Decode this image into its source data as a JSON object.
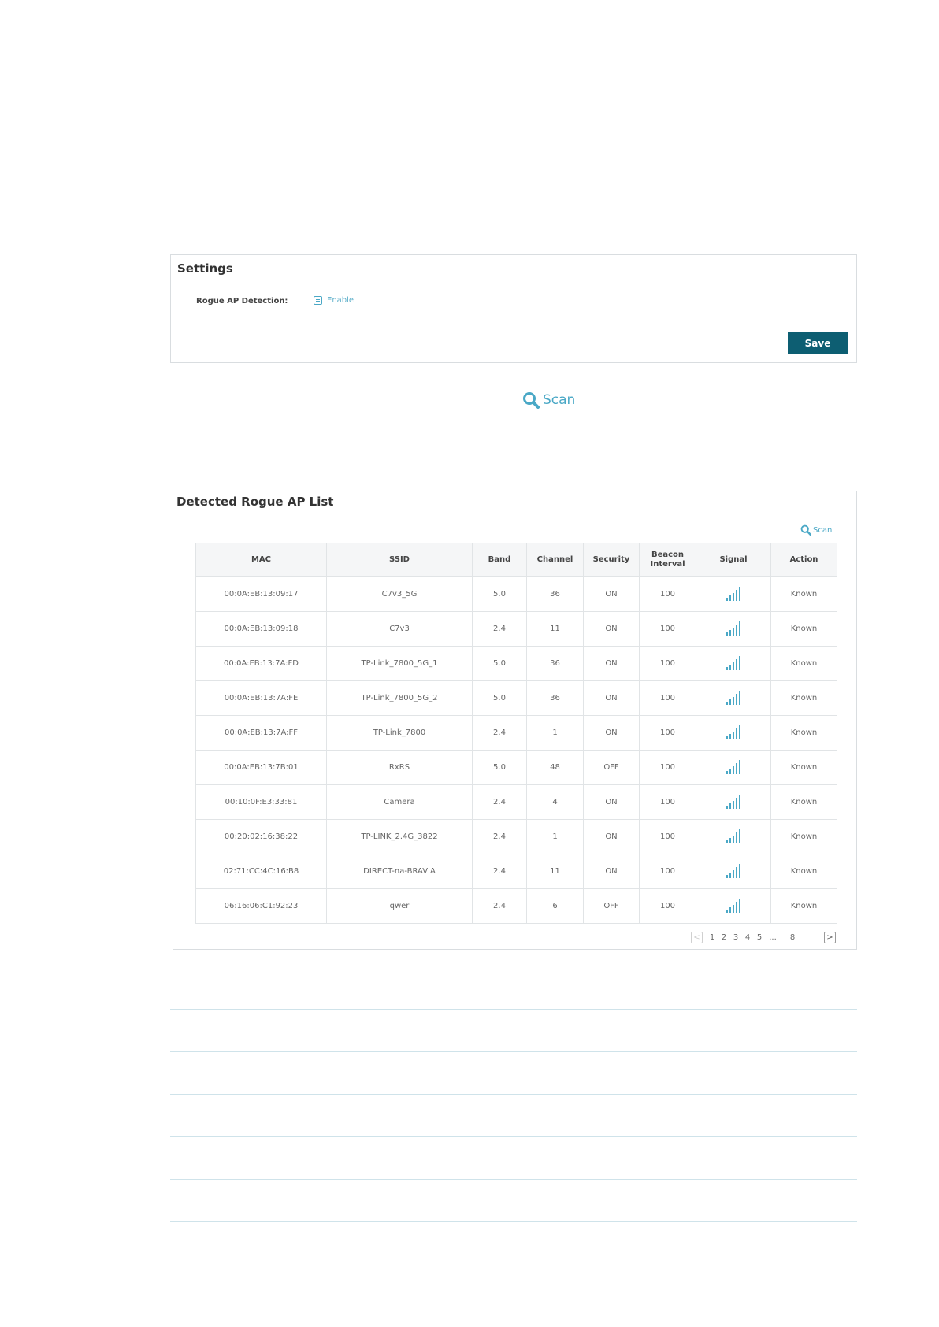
{
  "settings": {
    "title": "Settings",
    "rogue_label": "Rogue AP Detection:",
    "enable_label": "Enable",
    "save_label": "Save"
  },
  "scan_label": "Scan",
  "list": {
    "title": "Detected Rogue AP List",
    "scan_label": "Scan",
    "columns": [
      "MAC",
      "SSID",
      "Band",
      "Channel",
      "Security",
      "Beacon Interval",
      "Signal",
      "Action"
    ],
    "rows": [
      {
        "mac": "00:0A:EB:13:09:17",
        "ssid": "C7v3_5G",
        "band": "5.0",
        "channel": "36",
        "security": "ON",
        "beacon": "100",
        "action": "Known"
      },
      {
        "mac": "00:0A:EB:13:09:18",
        "ssid": "C7v3",
        "band": "2.4",
        "channel": "11",
        "security": "ON",
        "beacon": "100",
        "action": "Known"
      },
      {
        "mac": "00:0A:EB:13:7A:FD",
        "ssid": "TP-Link_7800_5G_1",
        "band": "5.0",
        "channel": "36",
        "security": "ON",
        "beacon": "100",
        "action": "Known"
      },
      {
        "mac": "00:0A:EB:13:7A:FE",
        "ssid": "TP-Link_7800_5G_2",
        "band": "5.0",
        "channel": "36",
        "security": "ON",
        "beacon": "100",
        "action": "Known"
      },
      {
        "mac": "00:0A:EB:13:7A:FF",
        "ssid": "TP-Link_7800",
        "band": "2.4",
        "channel": "1",
        "security": "ON",
        "beacon": "100",
        "action": "Known"
      },
      {
        "mac": "00:0A:EB:13:7B:01",
        "ssid": "RxRS",
        "band": "5.0",
        "channel": "48",
        "security": "OFF",
        "beacon": "100",
        "action": "Known"
      },
      {
        "mac": "00:10:0F:E3:33:81",
        "ssid": "Camera",
        "band": "2.4",
        "channel": "4",
        "security": "ON",
        "beacon": "100",
        "action": "Known"
      },
      {
        "mac": "00:20:02:16:38:22",
        "ssid": "TP-LINK_2.4G_3822",
        "band": "2.4",
        "channel": "1",
        "security": "ON",
        "beacon": "100",
        "action": "Known"
      },
      {
        "mac": "02:71:CC:4C:16:B8",
        "ssid": "DIRECT-na-BRAVIA",
        "band": "2.4",
        "channel": "11",
        "security": "ON",
        "beacon": "100",
        "action": "Known"
      },
      {
        "mac": "06:16:06:C1:92:23",
        "ssid": "qwer",
        "band": "2.4",
        "channel": "6",
        "security": "OFF",
        "beacon": "100",
        "action": "Known"
      }
    ]
  },
  "pagination": {
    "prev": "<",
    "pages": [
      "1",
      "2",
      "3",
      "4",
      "5"
    ],
    "ellipsis": "...",
    "last": "8",
    "next": ">"
  },
  "colors": {
    "accent": "#4aa8c6",
    "save_button": "#0d5e72"
  },
  "icons": {
    "scan": "magnifier-icon",
    "signal": "signal-bars-icon"
  }
}
